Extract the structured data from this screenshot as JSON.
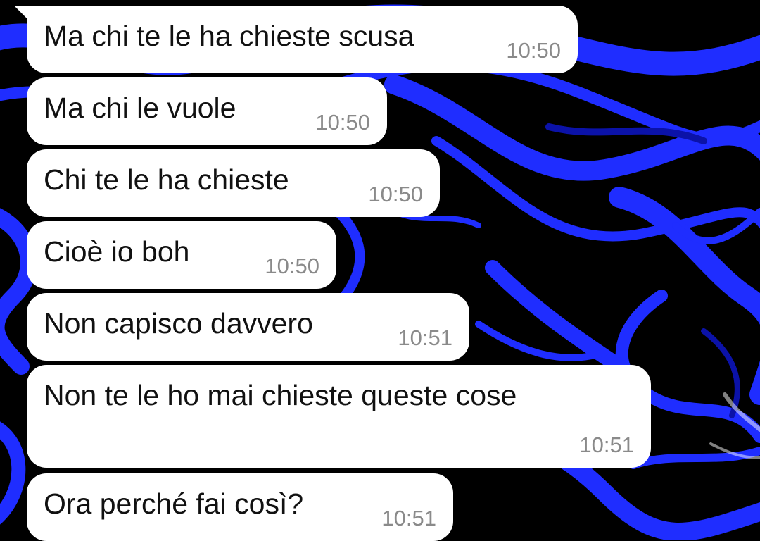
{
  "wallpaper": {
    "icon": "blue-marble-swirl-wallpaper",
    "base_color": "#000000",
    "accent_color": "#1f2dff"
  },
  "messages": [
    {
      "text": "Ma chi te le ha chieste scusa",
      "time": "10:50"
    },
    {
      "text": "Ma chi le vuole",
      "time": "10:50"
    },
    {
      "text": "Chi te le ha chieste",
      "time": "10:50"
    },
    {
      "text": "Cioè io boh",
      "time": "10:50"
    },
    {
      "text": "Non capisco davvero",
      "time": "10:51"
    },
    {
      "text": "Non te le ho mai chieste queste cose",
      "time": "10:51"
    },
    {
      "text": "Ora perché fai così?",
      "time": "10:51"
    }
  ]
}
